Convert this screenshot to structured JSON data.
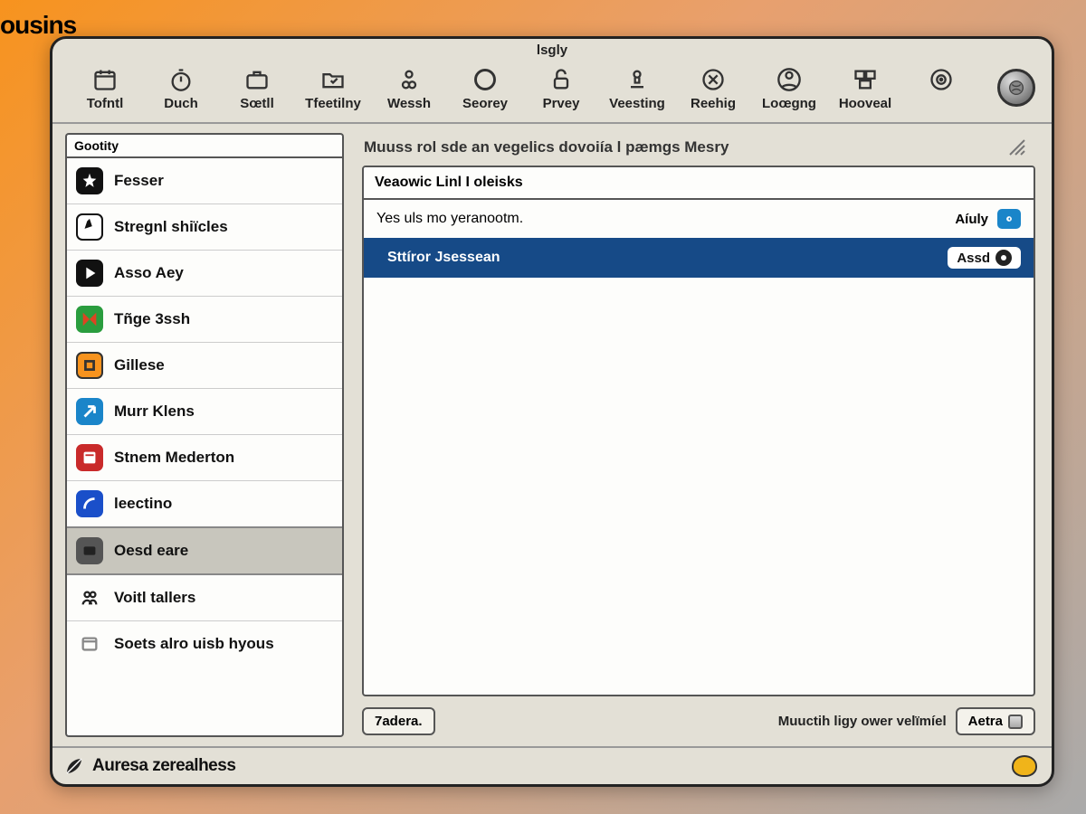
{
  "background": {
    "text": "ousins"
  },
  "window": {
    "title": "lsgly",
    "toolbar": [
      {
        "label": "Tofntl"
      },
      {
        "label": "Duch"
      },
      {
        "label": "Sœtll"
      },
      {
        "label": "Tfeetilny"
      },
      {
        "label": "Wessh"
      },
      {
        "label": "Seorey"
      },
      {
        "label": "Prvey"
      },
      {
        "label": "Veesting"
      },
      {
        "label": "Reehig"
      },
      {
        "label": "Loœgng"
      },
      {
        "label": "Hooveal"
      }
    ]
  },
  "sidebar": {
    "title": "Gootity",
    "items": [
      {
        "label": "Fesser"
      },
      {
        "label": "Stregnl shiïcles"
      },
      {
        "label": "Asso Aey"
      },
      {
        "label": "Tñge 3ssh"
      },
      {
        "label": "Gillese"
      },
      {
        "label": "Murr Klens"
      },
      {
        "label": "Stnem Mederton"
      },
      {
        "label": "leectino"
      },
      {
        "label": "Oesd eare",
        "selected": true
      },
      {
        "label": "Voitl tallers"
      },
      {
        "label": "Soets alro uisb hyous"
      }
    ]
  },
  "main": {
    "heading": "Muuss rol sde an vegelics dovoiía l pæmgs Mesry",
    "panel": {
      "header": "Veaowic Linl I oleisks",
      "rows": [
        {
          "label": "Yes uls mo yeranootm.",
          "tag": "Aíuly",
          "selected": false
        },
        {
          "label": "Sttíror Jsessean",
          "tag": "Assd",
          "selected": true
        }
      ]
    },
    "bottom": {
      "left_button": "7adera.",
      "status": "Muuctih ligy ower velïmíel",
      "right_button": "Aetra"
    }
  },
  "footer": {
    "text": "Auresa zerealhess"
  }
}
